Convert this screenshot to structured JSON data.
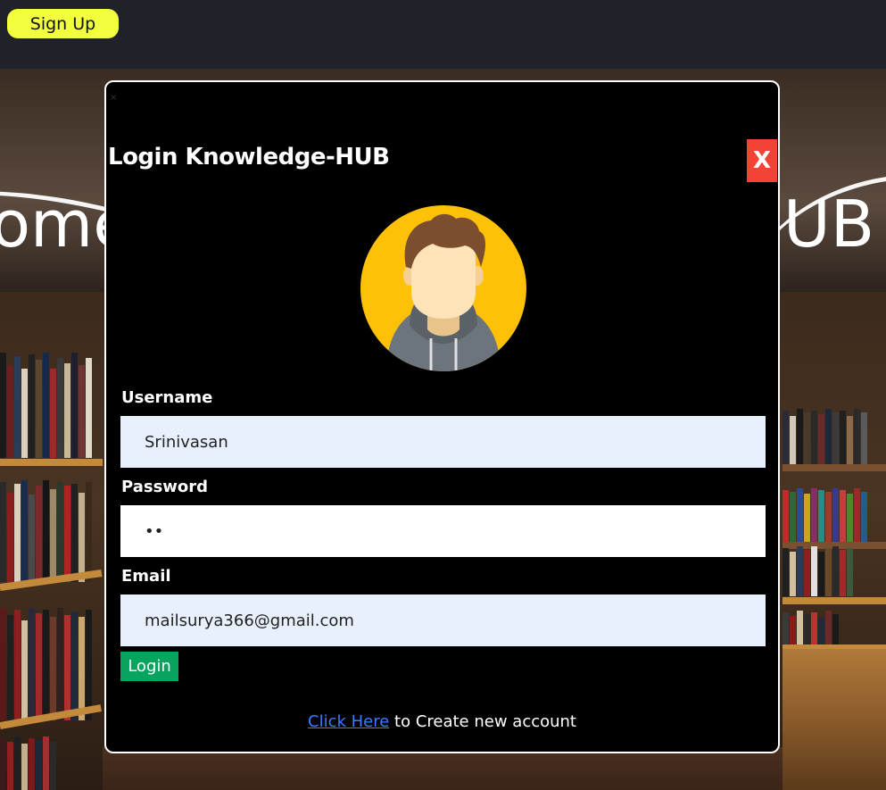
{
  "topbar": {
    "signup_label": "Sign Up"
  },
  "background": {
    "welcome_left": "ome",
    "welcome_right": "UB"
  },
  "modal": {
    "title": "Login Knowledge-HUB",
    "close_label": "X",
    "tiny_close": "×",
    "form": {
      "username_label": "Username",
      "username_value": "Srinivasan",
      "password_label": "Password",
      "password_value": "••",
      "email_label": "Email",
      "email_value": "mailsurya366@gmail.com",
      "login_label": "Login"
    },
    "footer": {
      "link_text": "Click Here",
      "rest_text": " to Create new account"
    }
  },
  "colors": {
    "signup_button": "#f2ff3f",
    "close_button": "#f44336",
    "login_button": "#08a35f",
    "input_autofill": "#e8f0fe",
    "link": "#3d7bff",
    "avatar_bg": "#ffc107"
  },
  "icons": {
    "avatar": "user-avatar-icon"
  }
}
